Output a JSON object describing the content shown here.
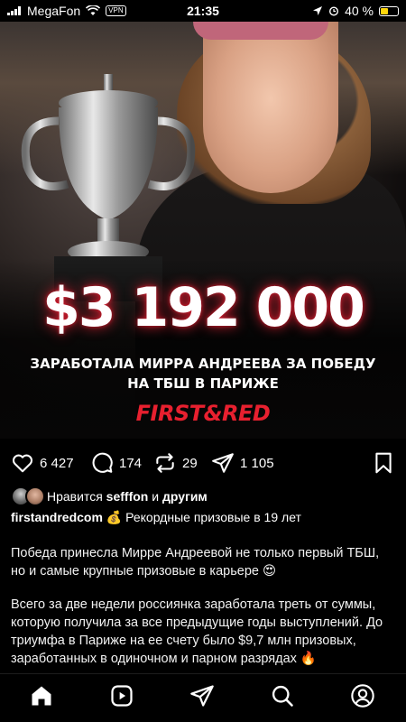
{
  "status_bar": {
    "carrier": "MegaFon",
    "vpn": "VPN",
    "time": "21:35",
    "battery": "40 %",
    "battery_level": 0.4
  },
  "post_image": {
    "amount": "$3 192 000",
    "subtitle_line1": "ЗАРАБОТАЛА МИРРА АНДРЕЕВА ЗА ПОБЕДУ",
    "subtitle_line2": "НА ТБШ В ПАРИЖЕ",
    "brand": "FIRST&RED"
  },
  "actions": {
    "likes": "6 427",
    "comments": "174",
    "reposts": "29",
    "shares": "1 105"
  },
  "liked_by": {
    "prefix": "Нравится",
    "user": "sefffon",
    "joiner": "и",
    "others": "другим"
  },
  "caption": {
    "username": "firstandredcom",
    "emoji": "💰",
    "text": "Рекордные призовые в 19 лет"
  },
  "body": {
    "paragraph1": "Победа принесла Мирре Андреевой не только первый ТБШ, но и самые крупные призовые в карьере 😍",
    "paragraph2": "Всего за две недели россиянка заработала треть от суммы, которую получила за все предыдущие годы выступлений. До триумфа в Париже на ее счету было $9,7 млн призовых, заработанных в одиночном и парном разрядах 🔥"
  },
  "colors": {
    "brand_red": "#e8202f",
    "battery_yellow": "#ffd60a",
    "background": "#000000"
  },
  "icons": {
    "like": "heart-icon",
    "comment": "comment-icon",
    "repost": "repost-icon",
    "share": "send-icon",
    "save": "bookmark-icon",
    "nav": [
      "home-icon",
      "reels-icon",
      "send-icon",
      "search-icon",
      "profile-icon"
    ]
  }
}
